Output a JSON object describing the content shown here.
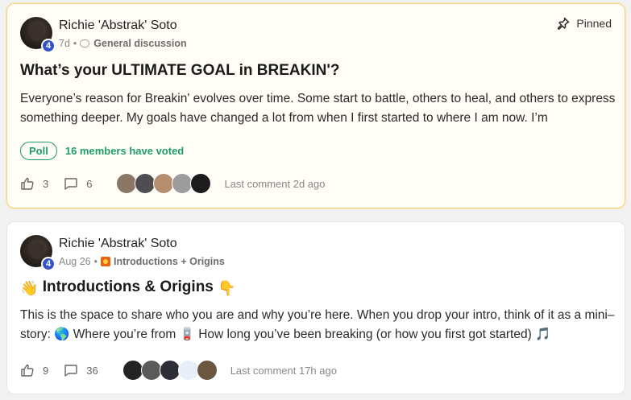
{
  "posts": [
    {
      "author": "Richie 'Abstrak' Soto",
      "level": "4",
      "time": "7d",
      "separator": "•",
      "category": "General discussion",
      "pinned_label": "Pinned",
      "title": "What’s your ULTIMATE GOAL in BREAKIN'?",
      "body": "Everyone’s reason for Breakin' evolves over time. Some start to battle, others to heal, and others to express something deeper. My goals have changed a lot from when I first started to where I am now. I’m",
      "poll_label": "Poll",
      "poll_votes": "16 members have voted",
      "likes": "3",
      "comments": "6",
      "last_comment": "Last comment 2d ago",
      "commenter_colors": [
        "#8a7766",
        "#4d4d52",
        "#b58e6f",
        "#9c9c9c",
        "#1c1c1c"
      ]
    },
    {
      "author": "Richie 'Abstrak' Soto",
      "level": "4",
      "time": "Aug 26",
      "separator": "•",
      "category": "Introductions + Origins",
      "title_emoji_left": "👋",
      "title": "Introductions & Origins",
      "title_emoji_right": "👇",
      "body": "This is the space to share who you are and why you’re here. When you drop your intro, think of it as a mini–story: 🌎 Where you’re from 🪫 How long you’ve been breaking (or how you first got started) 🎵",
      "likes": "9",
      "comments": "36",
      "last_comment": "Last comment 17h ago",
      "commenter_colors": [
        "#242424",
        "#5a5a5a",
        "#2d2d38",
        "#e8eef8",
        "#6b5740"
      ]
    }
  ],
  "icons": {
    "like": "thumbs-up-icon",
    "comment": "speech-bubble-icon",
    "pin": "pushpin-icon"
  }
}
